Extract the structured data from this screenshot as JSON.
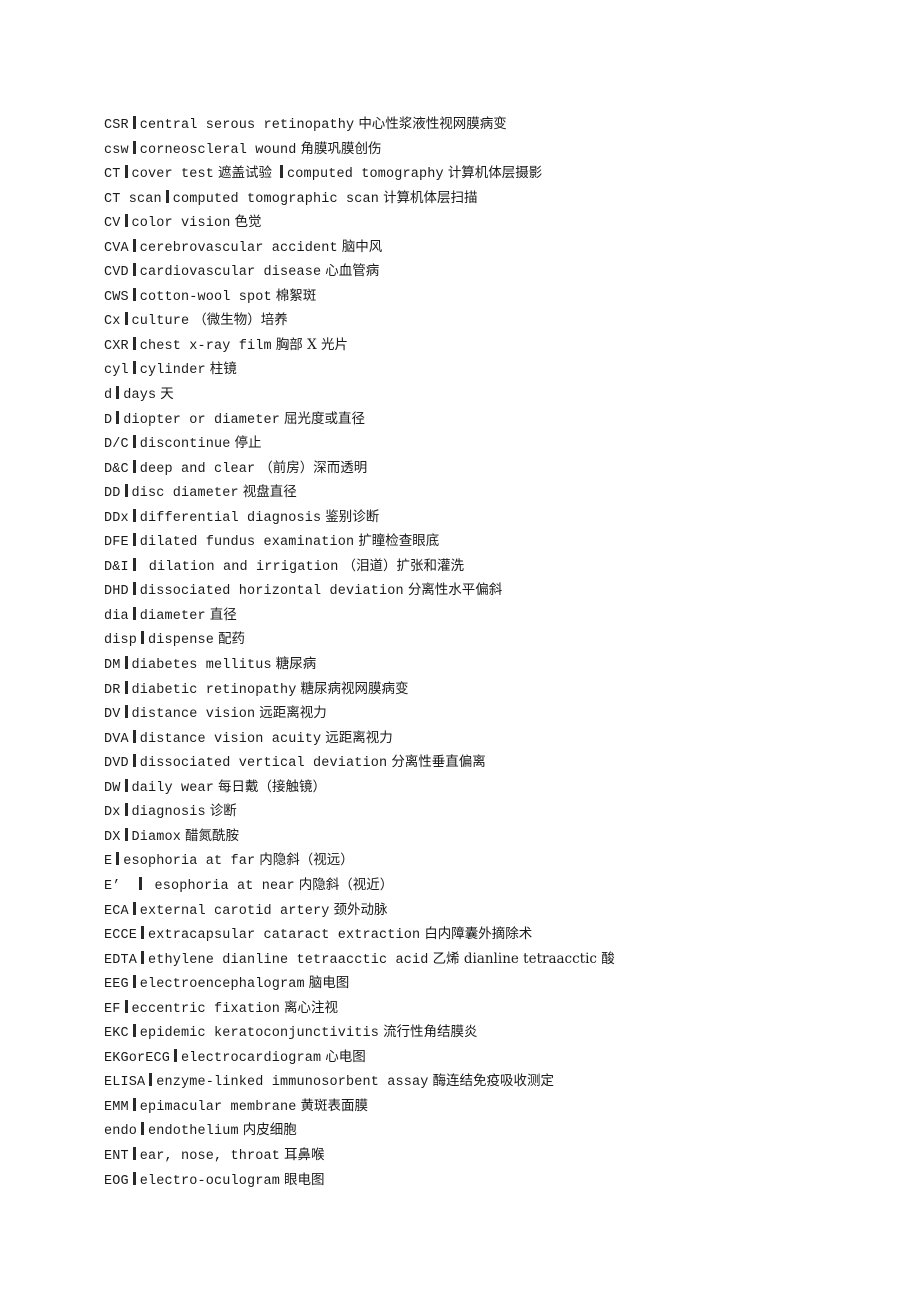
{
  "document": {
    "title": "Ophthalmology Abbreviations Glossary",
    "language_pair": "English-Chinese",
    "separator_glyph": "|"
  },
  "entries": [
    {
      "abbr": "CSR",
      "term": "central serous retinopathy",
      "cn": "中心性浆液性视网膜病变",
      "pre_sep_gap": false,
      "post_sep_gap": false
    },
    {
      "abbr": "csw",
      "term": "corneoscleral wound",
      "cn": "角膜巩膜创伤",
      "pre_sep_gap": false,
      "post_sep_gap": false
    },
    {
      "abbr": "CT",
      "term": "cover test",
      "cn": "遮盖试验",
      "term2": "computed tomography",
      "cn2": "计算机体层摄影",
      "pre_sep_gap": false,
      "post_sep_gap": false
    },
    {
      "abbr": "CT scan",
      "term": "computed tomographic scan",
      "cn": "计算机体层扫描",
      "pre_sep_gap": false,
      "post_sep_gap": false
    },
    {
      "abbr": "CV",
      "term": "color vision",
      "cn": "色觉",
      "pre_sep_gap": false,
      "post_sep_gap": false
    },
    {
      "abbr": "CVA",
      "term": "cerebrovascular accident",
      "cn": "脑中风",
      "pre_sep_gap": false,
      "post_sep_gap": false
    },
    {
      "abbr": "CVD",
      "term": "cardiovascular disease",
      "cn": "心血管病",
      "pre_sep_gap": false,
      "post_sep_gap": false
    },
    {
      "abbr": "CWS",
      "term": "cotton-wool spot",
      "cn": "棉絮斑",
      "pre_sep_gap": false,
      "post_sep_gap": false
    },
    {
      "abbr": "Cx",
      "term": "culture",
      "cn": "（微生物）培养",
      "pre_sep_gap": false,
      "post_sep_gap": false
    },
    {
      "abbr": "CXR",
      "term": "chest x-ray film",
      "cn": "胸部 X 光片",
      "pre_sep_gap": false,
      "post_sep_gap": false
    },
    {
      "abbr": "cyl",
      "term": "cylinder",
      "cn": "柱镜",
      "pre_sep_gap": false,
      "post_sep_gap": false
    },
    {
      "abbr": "d",
      "term": "days",
      "cn": "天",
      "pre_sep_gap": false,
      "post_sep_gap": false
    },
    {
      "abbr": "D",
      "term": "diopter or diameter",
      "cn": "屈光度或直径",
      "pre_sep_gap": false,
      "post_sep_gap": false
    },
    {
      "abbr": "D/C",
      "term": "discontinue",
      "cn": "停止",
      "pre_sep_gap": false,
      "post_sep_gap": false
    },
    {
      "abbr": "D&C",
      "term": "deep and clear",
      "cn": "（前房）深而透明",
      "pre_sep_gap": false,
      "post_sep_gap": false
    },
    {
      "abbr": "DD",
      "term": "disc diameter",
      "cn": "视盘直径",
      "pre_sep_gap": false,
      "post_sep_gap": false
    },
    {
      "abbr": "DDx",
      "term": "differential diagnosis",
      "cn": "鉴别诊断",
      "pre_sep_gap": false,
      "post_sep_gap": false
    },
    {
      "abbr": "DFE",
      "term": "dilated fundus examination",
      "cn": "扩瞳检查眼底",
      "pre_sep_gap": false,
      "post_sep_gap": false
    },
    {
      "abbr": "D&I",
      "term": "dilation and irrigation",
      "cn": "（泪道）扩张和灌洗",
      "pre_sep_gap": false,
      "post_sep_gap": true
    },
    {
      "abbr": "DHD",
      "term": "dissociated horizontal deviation",
      "cn": "分离性水平偏斜",
      "pre_sep_gap": false,
      "post_sep_gap": false
    },
    {
      "abbr": "dia",
      "term": "diameter",
      "cn": "直径",
      "pre_sep_gap": false,
      "post_sep_gap": false
    },
    {
      "abbr": "disp",
      "term": "dispense",
      "cn": "配药",
      "pre_sep_gap": false,
      "post_sep_gap": false
    },
    {
      "abbr": "DM",
      "term": "diabetes mellitus",
      "cn": "糖尿病",
      "pre_sep_gap": false,
      "post_sep_gap": false
    },
    {
      "abbr": "DR",
      "term": "diabetic retinopathy",
      "cn": "糖尿病视网膜病变",
      "pre_sep_gap": false,
      "post_sep_gap": false
    },
    {
      "abbr": "DV",
      "term": "distance vision",
      "cn": "远距离视力",
      "pre_sep_gap": false,
      "post_sep_gap": false
    },
    {
      "abbr": "DVA",
      "term": "distance vision acuity",
      "cn": "远距离视力",
      "pre_sep_gap": false,
      "post_sep_gap": false
    },
    {
      "abbr": "DVD",
      "term": "dissociated vertical deviation",
      "cn": "分离性垂直偏离",
      "pre_sep_gap": false,
      "post_sep_gap": false
    },
    {
      "abbr": "DW",
      "term": "daily wear",
      "cn": "每日戴（接触镜）",
      "pre_sep_gap": false,
      "post_sep_gap": false
    },
    {
      "abbr": "Dx",
      "term": "diagnosis",
      "cn": "诊断",
      "pre_sep_gap": false,
      "post_sep_gap": false
    },
    {
      "abbr": "DX",
      "term": "Diamox",
      "cn": "醋氮酰胺",
      "pre_sep_gap": false,
      "post_sep_gap": false
    },
    {
      "abbr": "E",
      "term": "esophoria at far",
      "cn": "内隐斜（视远）",
      "pre_sep_gap": false,
      "post_sep_gap": false
    },
    {
      "abbr": "E’",
      "term": "esophoria at near",
      "cn": "内隐斜（视近）",
      "pre_sep_gap": true,
      "post_sep_gap": true
    },
    {
      "abbr": "ECA",
      "term": "external carotid artery",
      "cn": "颈外动脉",
      "pre_sep_gap": false,
      "post_sep_gap": false
    },
    {
      "abbr": "ECCE",
      "term": "extracapsular cataract extraction",
      "cn": "白内障囊外摘除术",
      "pre_sep_gap": false,
      "post_sep_gap": false
    },
    {
      "abbr": "EDTA",
      "term": "ethylene dianline tetraacctic acid",
      "cn": "乙烯 dianline tetraacctic 酸",
      "pre_sep_gap": false,
      "post_sep_gap": false
    },
    {
      "abbr": "EEG",
      "term": "electroencephalogram",
      "cn": "脑电图",
      "pre_sep_gap": false,
      "post_sep_gap": false
    },
    {
      "abbr": "EF",
      "term": "eccentric fixation",
      "cn": "离心注视",
      "pre_sep_gap": false,
      "post_sep_gap": false
    },
    {
      "abbr": "EKC",
      "term": "epidemic keratoconjunctivitis",
      "cn": "流行性角结膜炎",
      "pre_sep_gap": false,
      "post_sep_gap": false
    },
    {
      "abbr": "EKGorECG",
      "term": "electrocardiogram",
      "cn": "心电图",
      "pre_sep_gap": false,
      "post_sep_gap": false
    },
    {
      "abbr": "ELISA",
      "term": "enzyme-linked immunosorbent assay",
      "cn": "酶连结免疫吸收测定",
      "pre_sep_gap": false,
      "post_sep_gap": false
    },
    {
      "abbr": "EMM",
      "term": "epimacular membrane",
      "cn": "黄斑表面膜",
      "pre_sep_gap": false,
      "post_sep_gap": false
    },
    {
      "abbr": "endo",
      "term": "endothelium",
      "cn": "内皮细胞",
      "pre_sep_gap": false,
      "post_sep_gap": false
    },
    {
      "abbr": "ENT",
      "term": "ear, nose, throat",
      "cn": "耳鼻喉",
      "pre_sep_gap": false,
      "post_sep_gap": false
    },
    {
      "abbr": "EOG",
      "term": "electro-oculogram",
      "cn": "眼电图",
      "pre_sep_gap": false,
      "post_sep_gap": false
    }
  ]
}
